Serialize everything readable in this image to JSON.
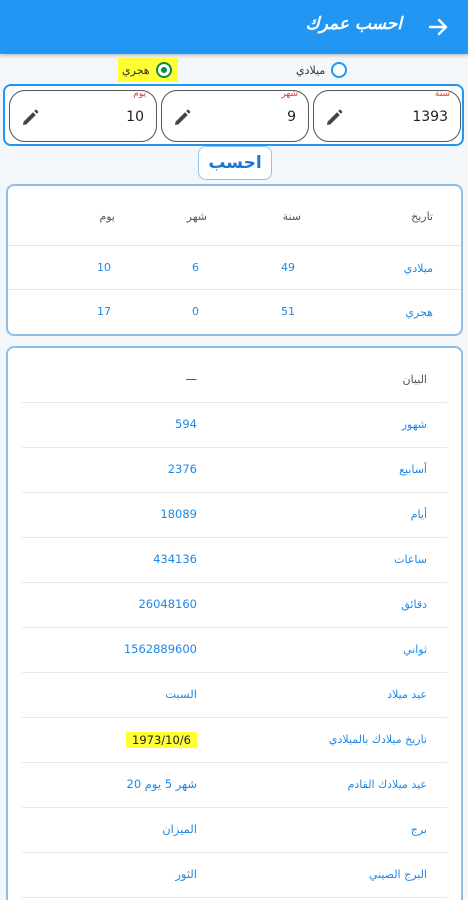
{
  "header": {
    "title": "احسب عمرك",
    "back_icon": "arrow-right-icon",
    "bg": "#2196f3"
  },
  "calendar": {
    "hijri_label": "هجري",
    "gregorian_label": "ميلادي",
    "selected": "hijri"
  },
  "inputs": {
    "year": {
      "label": "سنة",
      "value": "1393"
    },
    "month": {
      "label": "شهر",
      "value": "9"
    },
    "day": {
      "label": "يوم",
      "value": "10"
    }
  },
  "calculate_label": "احسب",
  "age_table": {
    "headers": [
      "تاريخ",
      "سنة",
      "شهر",
      "يوم"
    ],
    "rows": [
      {
        "label": "ميلادي",
        "year": "49",
        "month": "6",
        "day": "10"
      },
      {
        "label": "هجري",
        "year": "51",
        "month": "0",
        "day": "17"
      }
    ]
  },
  "details": {
    "header": {
      "label": "البيان",
      "value": "—"
    },
    "rows": [
      {
        "label": "شهور",
        "value": "594"
      },
      {
        "label": "أسابيع",
        "value": "2376"
      },
      {
        "label": "أيام",
        "value": "18089"
      },
      {
        "label": "ساعات",
        "value": "434136"
      },
      {
        "label": "دقائق",
        "value": "26048160"
      },
      {
        "label": "ثواني",
        "value": "1562889600"
      },
      {
        "label": "عيد ميلاد",
        "value": "السبت"
      },
      {
        "label": "تاريخ ميلادك بالميلادي",
        "value": "1973/10/6"
      },
      {
        "label": "عيد ميلادك القادم",
        "value": "شهر 5 يوم 20"
      },
      {
        "label": "برج",
        "value": "الميزان"
      },
      {
        "label": "البرج الصيني",
        "value": "الثور"
      }
    ]
  },
  "colors": {
    "accent": "#2196f3",
    "link": "#1e88e5",
    "highlight": "#ffff33",
    "required": "#e53935"
  }
}
